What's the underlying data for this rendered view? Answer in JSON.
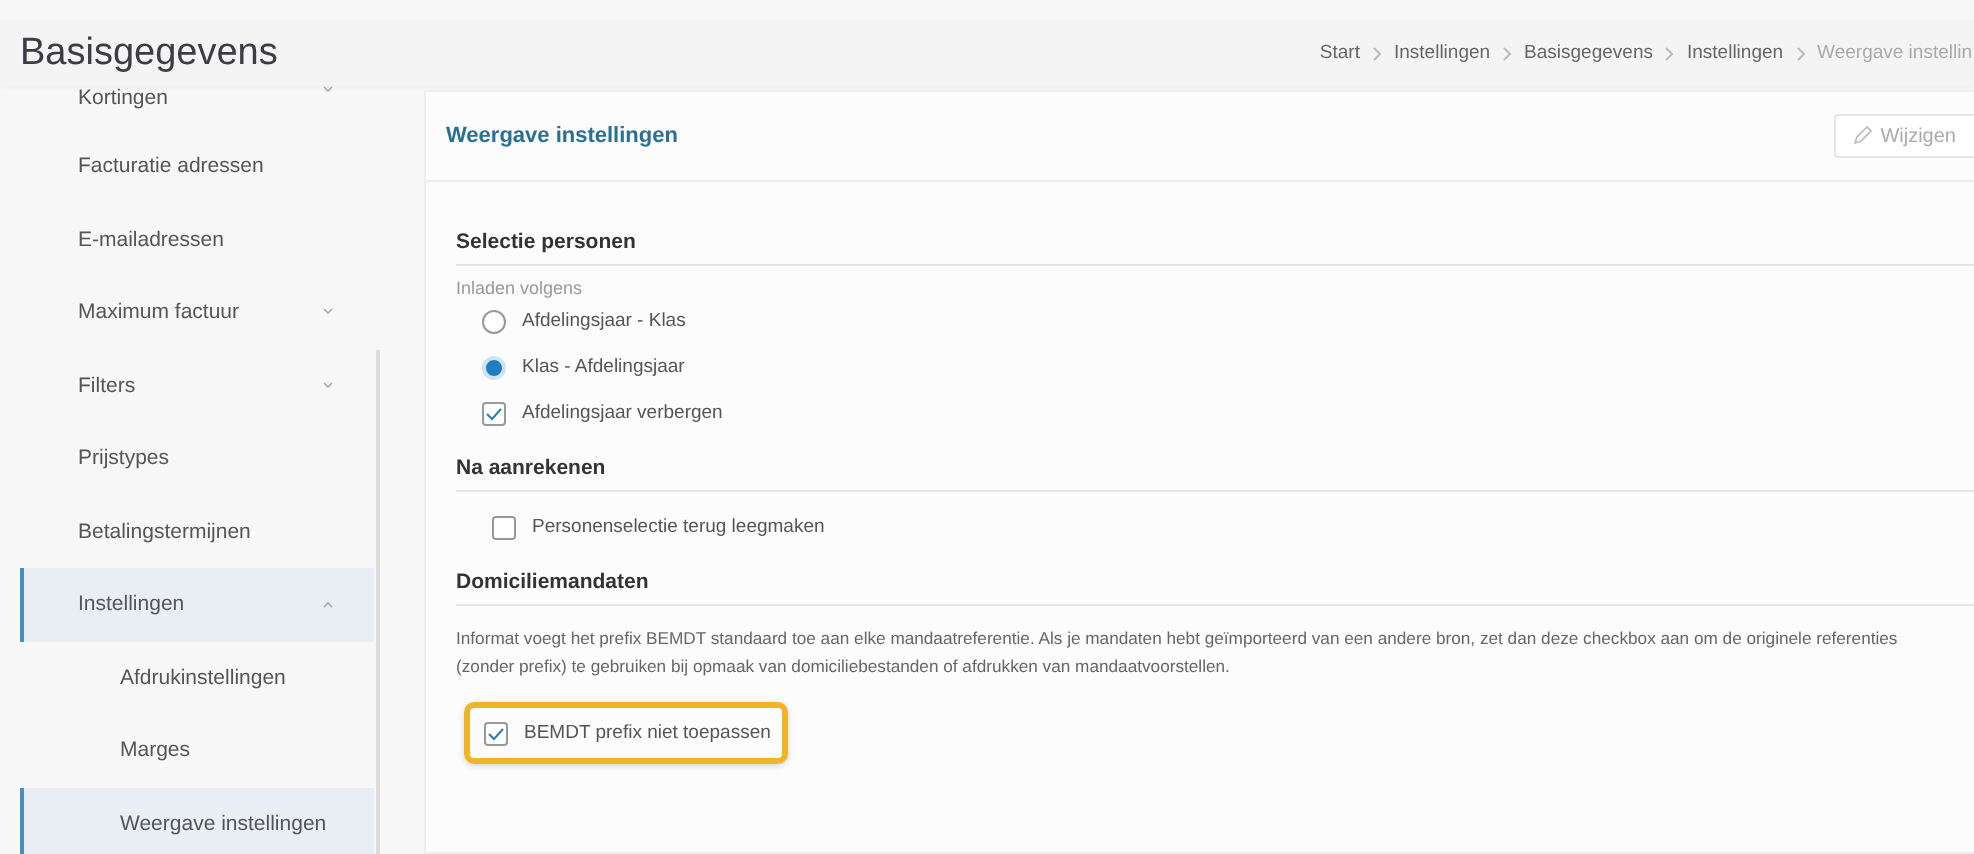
{
  "page_title": "Basisgegevens",
  "breadcrumb": [
    {
      "label": "Start",
      "current": false
    },
    {
      "label": "Instellingen",
      "current": false
    },
    {
      "label": "Basisgegevens",
      "current": false
    },
    {
      "label": "Instellingen",
      "current": false
    },
    {
      "label": "Weergave instellin",
      "current": true
    }
  ],
  "sidebar": {
    "items": [
      {
        "label": "Kortingen",
        "expandable": true,
        "expanded": false,
        "selected": false
      },
      {
        "label": "Facturatie adressen",
        "expandable": false,
        "selected": false
      },
      {
        "label": "E-mailadressen",
        "expandable": false,
        "selected": false
      },
      {
        "label": "Maximum factuur",
        "expandable": true,
        "expanded": false,
        "selected": false
      },
      {
        "label": "Filters",
        "expandable": true,
        "expanded": false,
        "selected": false
      },
      {
        "label": "Prijstypes",
        "expandable": false,
        "selected": false
      },
      {
        "label": "Betalingstermijnen",
        "expandable": false,
        "selected": false
      },
      {
        "label": "Instellingen",
        "expandable": true,
        "expanded": true,
        "selected": true,
        "children": [
          {
            "label": "Afdrukinstellingen",
            "selected": false
          },
          {
            "label": "Marges",
            "selected": false
          },
          {
            "label": "Weergave instellingen",
            "selected": true
          }
        ]
      }
    ]
  },
  "panel": {
    "title": "Weergave instellingen",
    "edit_button": "Wijzigen",
    "sections": [
      {
        "title": "Selectie personen",
        "field_label": "Inladen volgens",
        "options": [
          {
            "kind": "radio",
            "label": "Afdelingsjaar - Klas",
            "checked": false,
            "highlighted": false
          },
          {
            "kind": "radio",
            "label": "Klas - Afdelingsjaar",
            "checked": true,
            "highlighted": false
          },
          {
            "kind": "checkbox",
            "label": "Afdelingsjaar verbergen",
            "checked": true,
            "highlighted": false
          }
        ]
      },
      {
        "title": "Na aanrekenen",
        "options": [
          {
            "kind": "checkbox",
            "label": "Personenselectie terug leegmaken",
            "checked": false,
            "highlighted": false
          }
        ]
      },
      {
        "title": "Domiciliemandaten",
        "description": "Informat voegt het prefix BEMDT standaard toe aan elke mandaatreferentie. Als je mandaten hebt geïmporteerd van een andere bron, zet dan deze checkbox aan om de originele referenties (zonder prefix) te gebruiken bij opmaak van domiciliebestanden of afdrukken van mandaatvoorstellen.",
        "options": [
          {
            "kind": "checkbox",
            "label": "BEMDT prefix niet toepassen",
            "checked": true,
            "highlighted": true
          }
        ]
      }
    ]
  }
}
